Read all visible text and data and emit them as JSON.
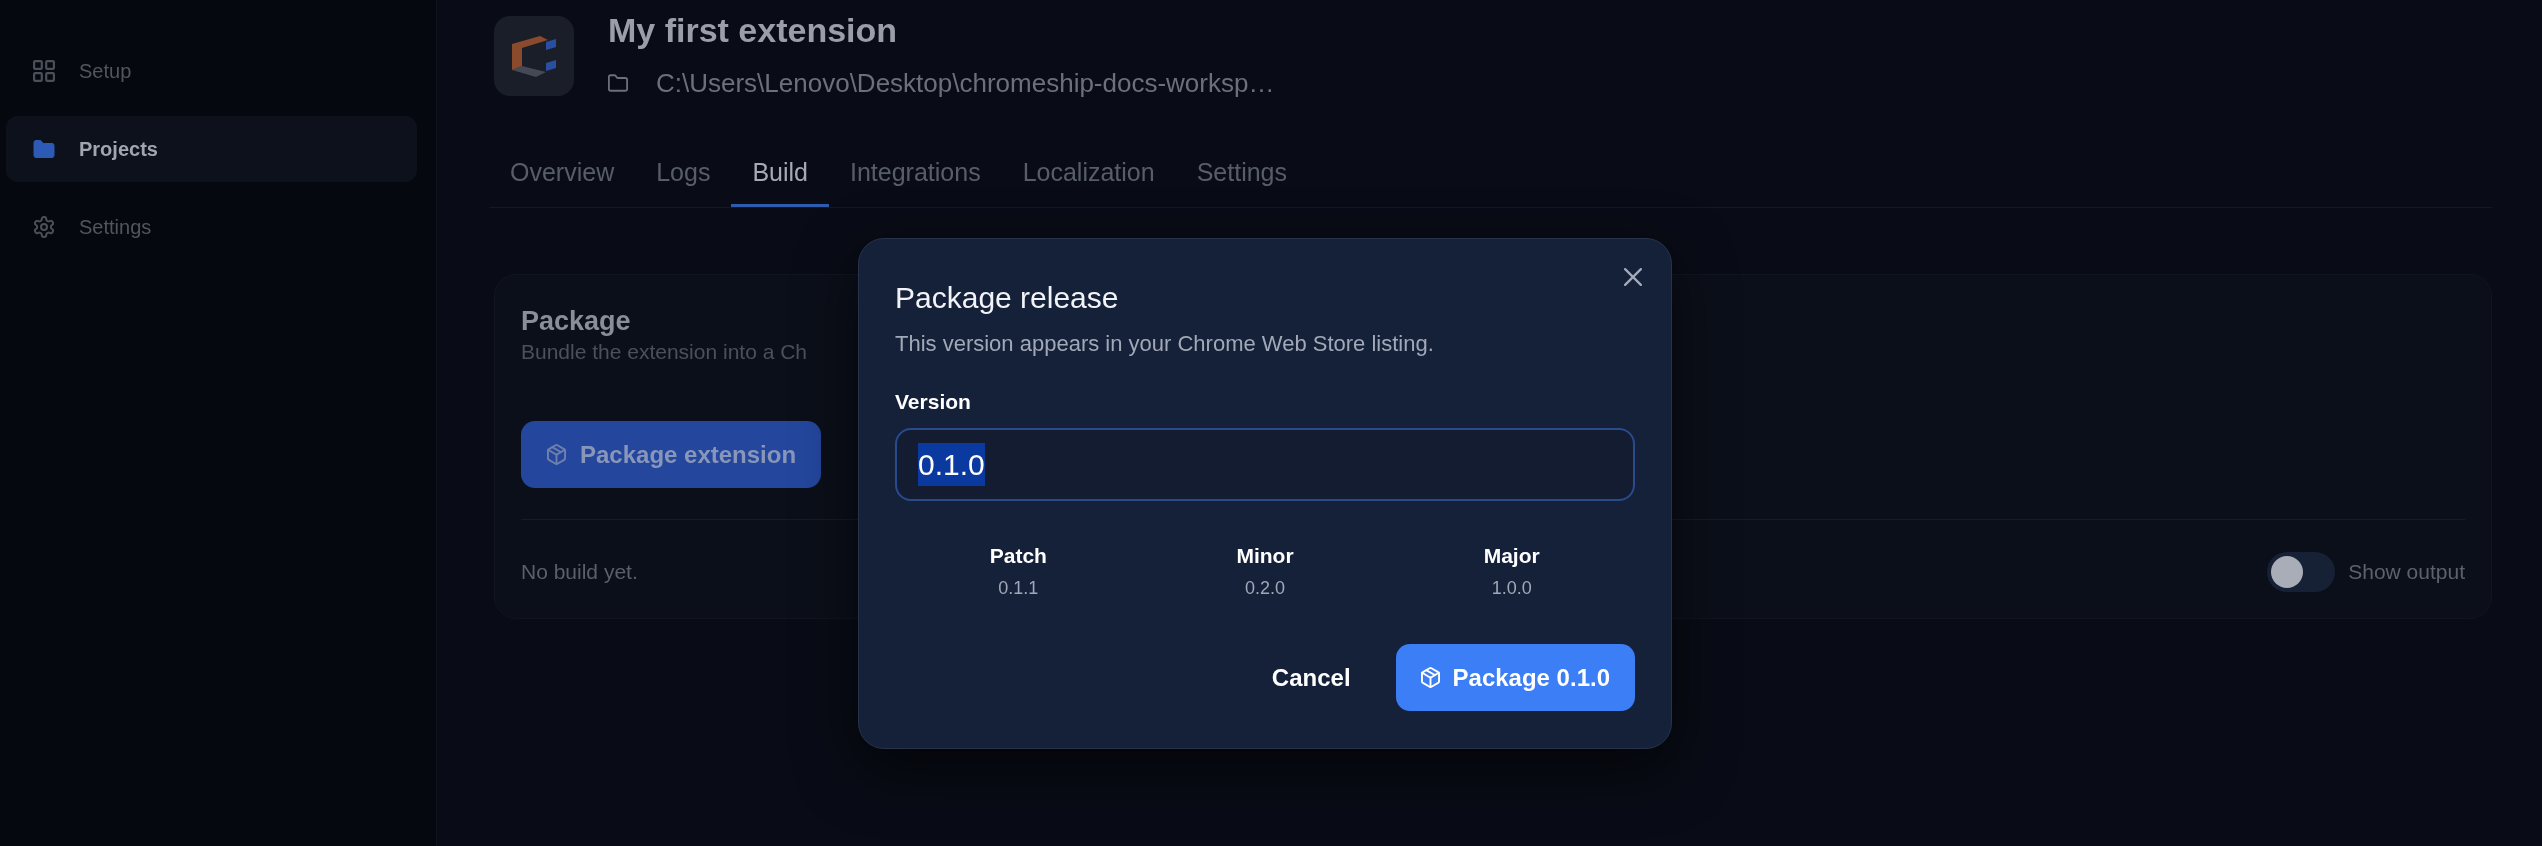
{
  "sidebar": {
    "items": [
      {
        "label": "Setup",
        "selected": false
      },
      {
        "label": "Projects",
        "selected": true
      },
      {
        "label": "Settings",
        "selected": false
      }
    ]
  },
  "project": {
    "title": "My first extension",
    "path": "C:\\Users\\Lenovo\\Desktop\\chromeship-docs-worksp…"
  },
  "tabs": [
    {
      "label": "Overview",
      "selected": false
    },
    {
      "label": "Logs",
      "selected": false
    },
    {
      "label": "Build",
      "selected": true
    },
    {
      "label": "Integrations",
      "selected": false
    },
    {
      "label": "Localization",
      "selected": false
    },
    {
      "label": "Settings",
      "selected": false
    }
  ],
  "package_card": {
    "title": "Package",
    "description": "Bundle the extension into a Ch",
    "button": "Package extension",
    "status": "No build yet.",
    "show_output": {
      "label": "Show output",
      "on": false
    }
  },
  "dialog": {
    "title": "Package release",
    "description": "This version appears in your Chrome Web Store listing.",
    "field": {
      "label": "Version",
      "value": "0.1.0",
      "text_selected": true
    },
    "bumps": [
      {
        "label": "Patch",
        "version": "0.1.1"
      },
      {
        "label": "Minor",
        "version": "0.2.0"
      },
      {
        "label": "Major",
        "version": "1.0.0"
      }
    ],
    "cancel": "Cancel",
    "confirm": "Package 0.1.0"
  }
}
